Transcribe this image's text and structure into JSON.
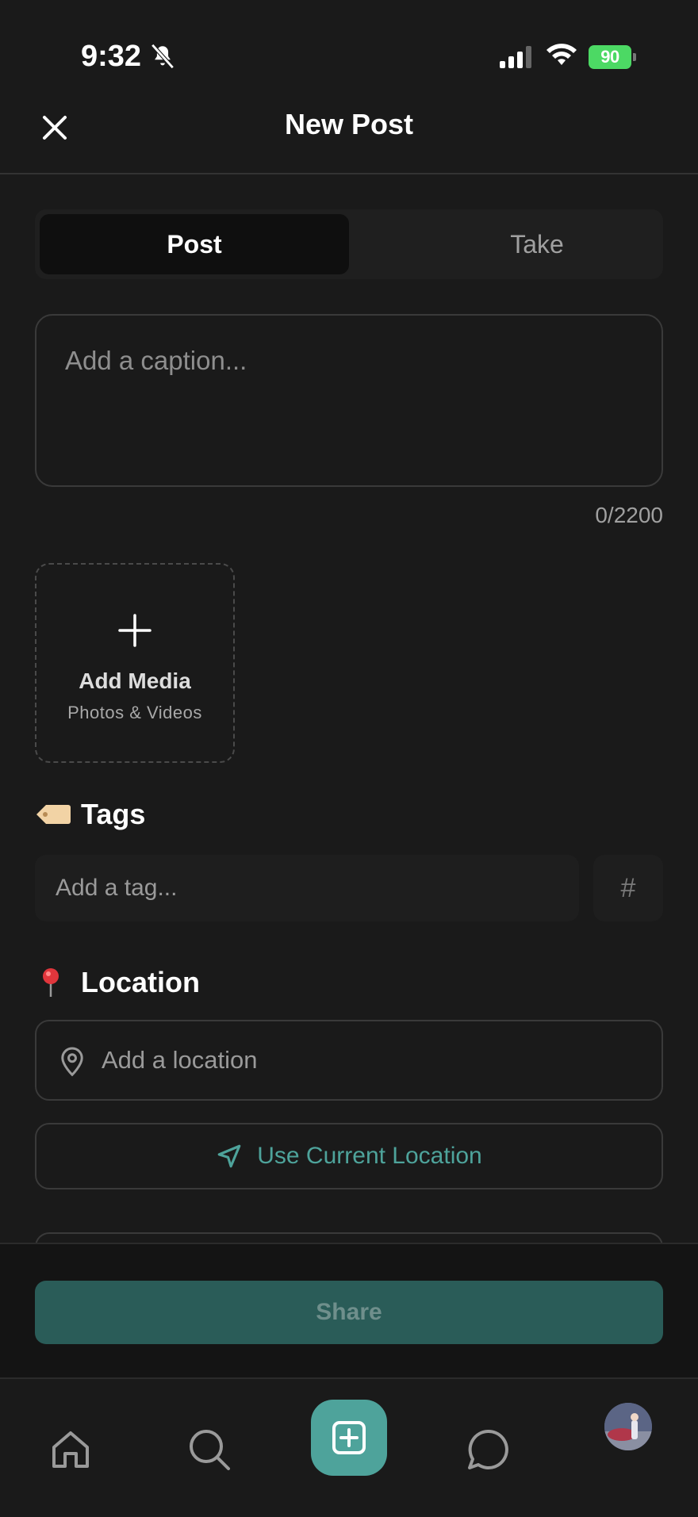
{
  "status_bar": {
    "time": "9:32",
    "battery": "90",
    "icons": [
      "bell-slash-icon",
      "signal-icon",
      "wifi-icon",
      "battery-icon"
    ]
  },
  "header": {
    "title": "New Post",
    "close_icon": "close-icon"
  },
  "segments": {
    "items": [
      {
        "label": "Post",
        "active": true
      },
      {
        "label": "Take",
        "active": false
      }
    ]
  },
  "caption": {
    "placeholder": "Add a caption...",
    "value": "",
    "count": "0/2200"
  },
  "media": {
    "title": "Add Media",
    "subtitle": "Photos & Videos",
    "icon": "plus-icon"
  },
  "tags": {
    "heading": "Tags",
    "emoji_icon": "label-tag-icon",
    "placeholder": "Add a tag...",
    "hash_label": "#"
  },
  "location": {
    "heading": "Location",
    "emoji_icon": "round-pushpin-icon",
    "placeholder": "Add a location",
    "use_current_label": "Use Current Location"
  },
  "share": {
    "label": "Share"
  },
  "tab_bar": {
    "items": [
      "home-icon",
      "search-icon",
      "create-post-icon",
      "chat-icon",
      "profile-avatar"
    ]
  },
  "colors": {
    "background": "#1a1a1a",
    "accent": "#4ea39b",
    "share_disabled": "#2a5c58",
    "battery": "#4cd964"
  }
}
